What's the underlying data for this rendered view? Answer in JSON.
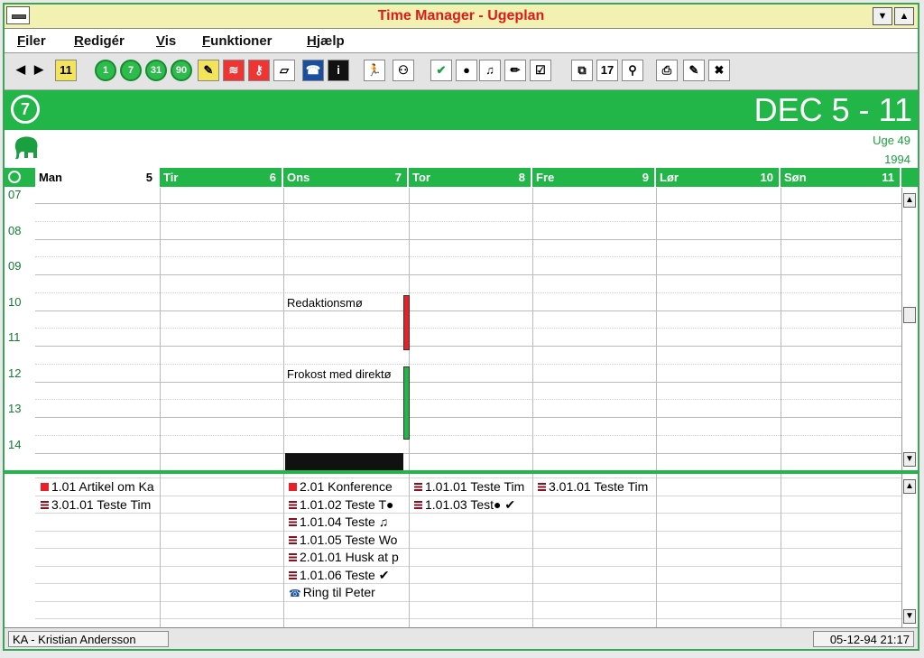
{
  "window": {
    "title": "Time Manager - Ugeplan"
  },
  "menu": [
    {
      "label": "Filer"
    },
    {
      "label": "Redigér"
    },
    {
      "label": "Vis"
    },
    {
      "label": "Funktioner"
    },
    {
      "label": "Hjælp"
    }
  ],
  "toolbar": {
    "buttons": [
      {
        "name": "prev-arrow-icon",
        "glyph": "◀"
      },
      {
        "name": "next-arrow-icon",
        "glyph": "▶"
      },
      {
        "name": "today-calendar-icon",
        "glyph": "11"
      },
      {
        "name": "day-view-icon",
        "glyph": "1"
      },
      {
        "name": "week-view-icon",
        "glyph": "7"
      },
      {
        "name": "month-view-icon",
        "glyph": "31"
      },
      {
        "name": "quarter-view-icon",
        "glyph": "90"
      },
      {
        "name": "notes-icon",
        "glyph": "✎"
      },
      {
        "name": "wireless-icon",
        "glyph": "≋"
      },
      {
        "name": "key-icon",
        "glyph": "⚷"
      },
      {
        "name": "eraser-icon",
        "glyph": "▱"
      },
      {
        "name": "phone-icon",
        "glyph": "☎"
      },
      {
        "name": "info-icon",
        "glyph": "i"
      },
      {
        "name": "running-man-icon",
        "glyph": "🏃"
      },
      {
        "name": "meeting-icon",
        "glyph": "⚇"
      },
      {
        "name": "checkmark-icon",
        "glyph": "✔"
      },
      {
        "name": "bullet-icon",
        "glyph": "●"
      },
      {
        "name": "music-note-icon",
        "glyph": "♫"
      },
      {
        "name": "pencil-icon",
        "glyph": "✏"
      },
      {
        "name": "checkbox-pencil-icon",
        "glyph": "☑"
      },
      {
        "name": "copy-icon",
        "glyph": "⧉"
      },
      {
        "name": "calendar-icon",
        "glyph": "17"
      },
      {
        "name": "search-icon",
        "glyph": "⚲"
      },
      {
        "name": "print-icon",
        "glyph": "⎙"
      },
      {
        "name": "edit-disabled-icon",
        "glyph": "✎"
      },
      {
        "name": "delete-disabled-icon",
        "glyph": "✖"
      }
    ]
  },
  "header": {
    "range": "DEC 5 - 11",
    "week": "Uge 49",
    "year": "1994"
  },
  "days": [
    {
      "name": "Man",
      "date": "5"
    },
    {
      "name": "Tir",
      "date": "6"
    },
    {
      "name": "Ons",
      "date": "7"
    },
    {
      "name": "Tor",
      "date": "8"
    },
    {
      "name": "Fre",
      "date": "9"
    },
    {
      "name": "Lør",
      "date": "10"
    },
    {
      "name": "Søn",
      "date": "11"
    }
  ],
  "hours": [
    "07",
    "08",
    "09",
    "10",
    "11",
    "12",
    "13",
    "14"
  ],
  "appointments": [
    {
      "text": "Redaktionsmø",
      "day": "Ons",
      "start": "10",
      "end": "11:30",
      "color": "#e8202a"
    },
    {
      "text": "Frokost med direktø",
      "day": "Ons",
      "start": "12",
      "end": "14",
      "color": "#22b548"
    }
  ],
  "tasks": {
    "Man": [
      {
        "marker": "red",
        "text": "1.01 Artikel om Ka"
      },
      {
        "marker": "lines",
        "text": "3.01.01 Teste Tim"
      }
    ],
    "Ons": [
      {
        "marker": "red",
        "text": "2.01 Konference"
      },
      {
        "marker": "lines",
        "text": "1.01.02 Teste T●"
      },
      {
        "marker": "lines",
        "text": "1.01.04 Teste ♫"
      },
      {
        "marker": "lines",
        "text": "1.01.05 Teste Wo"
      },
      {
        "marker": "lines",
        "text": "2.01.01 Husk at p"
      },
      {
        "marker": "lines",
        "text": "1.01.06 Teste ✔"
      },
      {
        "marker": "phone",
        "text": "Ring til Peter"
      }
    ],
    "Tor": [
      {
        "marker": "lines",
        "text": "1.01.01 Teste Tim"
      },
      {
        "marker": "lines",
        "text": "1.01.03 Test● ✔"
      }
    ],
    "Fre": [
      {
        "marker": "lines",
        "text": "3.01.01 Teste Tim"
      }
    ]
  },
  "status": {
    "user": "KA - Kristian Andersson",
    "datetime": "05-12-94 21:17"
  }
}
